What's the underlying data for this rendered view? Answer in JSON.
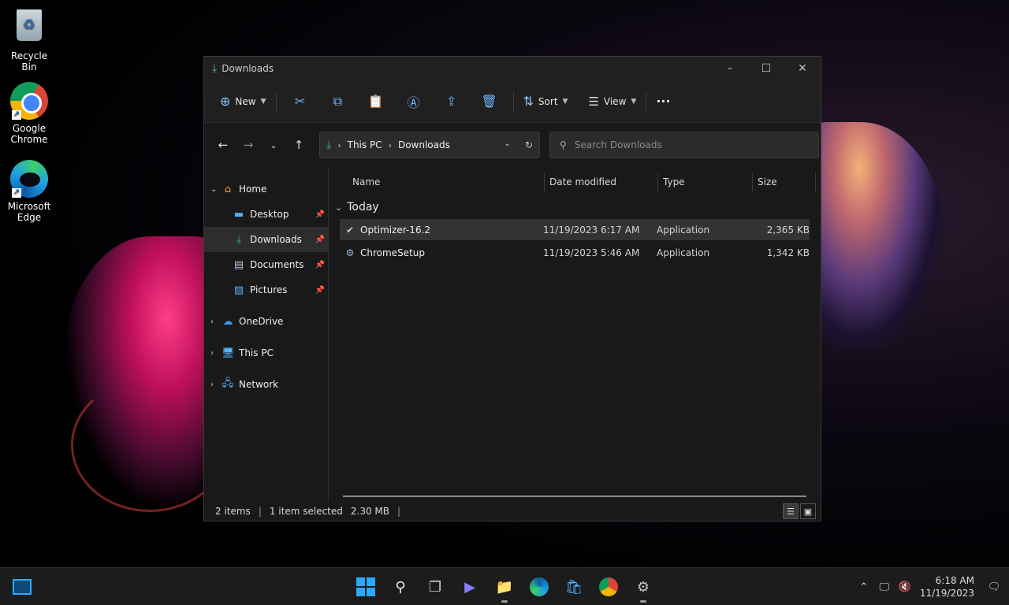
{
  "desktop": {
    "icons": [
      {
        "label": "Recycle Bin"
      },
      {
        "label": "Google Chrome"
      },
      {
        "label": "Microsoft Edge"
      }
    ]
  },
  "window": {
    "title": "Downloads",
    "toolbar": {
      "new_label": "New",
      "sort_label": "Sort",
      "view_label": "View",
      "more_label": "···"
    },
    "address": {
      "crumbs": [
        "This PC",
        "Downloads"
      ]
    },
    "search": {
      "placeholder": "Search Downloads"
    },
    "sidebar": {
      "items": [
        {
          "label": "Home",
          "icon": "home-icon"
        },
        {
          "label": "Desktop",
          "icon": "desktop-icon",
          "pinned": true
        },
        {
          "label": "Downloads",
          "icon": "download-icon",
          "pinned": true,
          "selected": true
        },
        {
          "label": "Documents",
          "icon": "document-icon",
          "pinned": true
        },
        {
          "label": "Pictures",
          "icon": "pictures-icon",
          "pinned": true
        },
        {
          "label": "OneDrive",
          "icon": "cloud-icon"
        },
        {
          "label": "This PC",
          "icon": "computer-icon"
        },
        {
          "label": "Network",
          "icon": "network-icon"
        }
      ]
    },
    "columns": {
      "name": "Name",
      "date": "Date modified",
      "type": "Type",
      "size": "Size"
    },
    "group": "Today",
    "files": [
      {
        "name": "Optimizer-16.2",
        "date": "11/19/2023 6:17 AM",
        "type": "Application",
        "size": "2,365 KB",
        "selected": true
      },
      {
        "name": "ChromeSetup",
        "date": "11/19/2023 5:46 AM",
        "type": "Application",
        "size": "1,342 KB",
        "selected": false
      }
    ],
    "status": {
      "count": "2 items",
      "selection": "1 item selected",
      "sel_size": "2.30 MB"
    }
  },
  "taskbar": {
    "time": "6:18 AM",
    "date": "11/19/2023"
  },
  "colors": {
    "accent": "#2ea8ff",
    "download_green": "#3dbf6a"
  }
}
